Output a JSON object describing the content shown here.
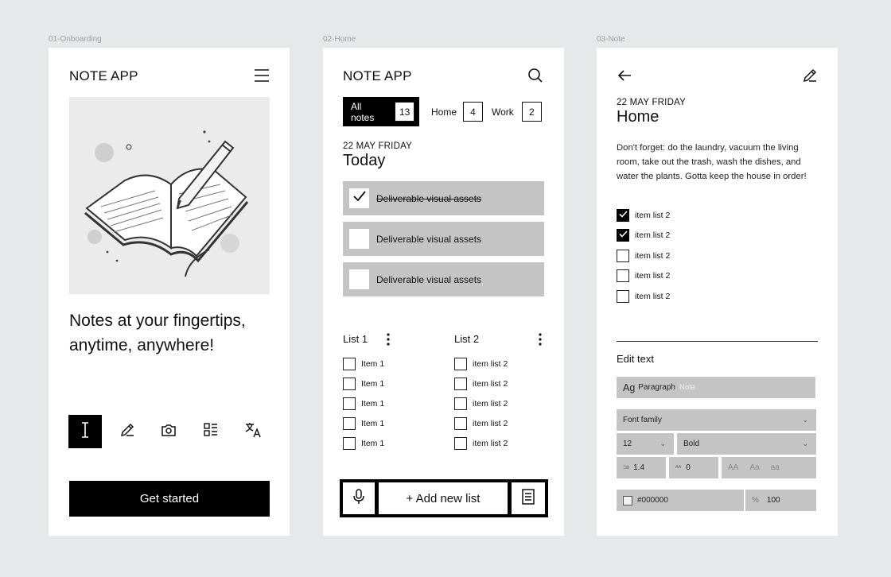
{
  "frames": {
    "onboarding": {
      "label": "01-Onboarding",
      "title": "NOTE APP",
      "headline": "Notes at your fingertips, anytime, anywhere!",
      "tools": [
        "text-cursor-icon",
        "pencil-icon",
        "camera-icon",
        "list-icon",
        "translate-icon"
      ],
      "cta": "Get started"
    },
    "home": {
      "label": "02-Home",
      "title": "NOTE APP",
      "chips": [
        {
          "label": "All notes",
          "count": "13",
          "active": true
        },
        {
          "label": "Home",
          "count": "4",
          "active": false
        },
        {
          "label": "Work",
          "count": "2",
          "active": false
        }
      ],
      "date": "22 MAY FRIDAY",
      "day": "Today",
      "tasks": [
        {
          "text": "Deliverable visual assets",
          "done": true
        },
        {
          "text": "Deliverable visual assets",
          "done": false
        },
        {
          "text": "Deliverable visual assets",
          "done": false
        }
      ],
      "lists": [
        {
          "title": "List 1",
          "items": [
            "Item 1",
            "Item 1",
            "Item 1",
            "Item 1",
            "Item 1"
          ]
        },
        {
          "title": "List 2",
          "items": [
            "item list 2",
            "item list 2",
            "item list 2",
            "item list 2",
            "item list 2"
          ]
        }
      ],
      "add_label": "+ Add new list"
    },
    "note": {
      "label": "03-Note",
      "date": "22 MAY FRIDAY",
      "title": "Home",
      "body": "Don't forget: do the laundry, vacuum the living room, take out the trash, wash the dishes, and water the plants. Gotta keep the house in order!",
      "checklist": [
        {
          "text": "item list 2",
          "checked": true
        },
        {
          "text": "item list 2",
          "checked": true
        },
        {
          "text": "item list 2",
          "checked": false
        },
        {
          "text": "item list 2",
          "checked": false
        },
        {
          "text": "item list 2",
          "checked": false
        }
      ],
      "edit_heading": "Edit text",
      "style_ag": "Ag",
      "style_name": "Paragraph",
      "style_hint": "Note",
      "font_family": "Font family",
      "font_size": "12",
      "font_weight": "Bold",
      "line_height": "1.4",
      "letter_spacing": "0",
      "case_options": [
        "AA",
        "Aa",
        "aa"
      ],
      "color_value": "#000000",
      "opacity_symbol": "%",
      "opacity_value": "100"
    }
  },
  "colors": {
    "background": "#e7e8ea",
    "frame": "#ffffff",
    "field": "#c4c4c4",
    "ink": "#000000"
  }
}
